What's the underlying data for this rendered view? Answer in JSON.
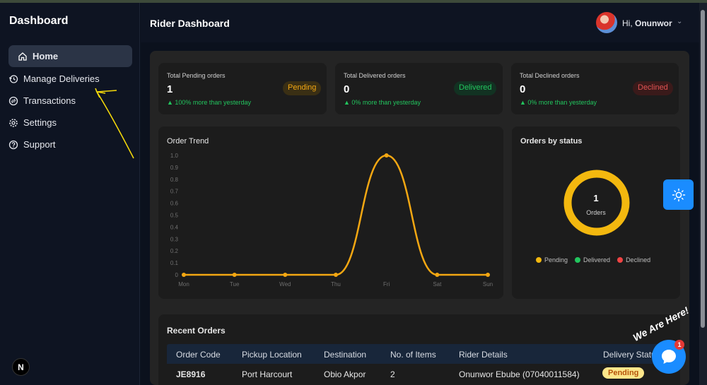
{
  "sidebar": {
    "brand": "Dashboard",
    "items": [
      {
        "label": "Home",
        "icon": "home-icon",
        "active": true
      },
      {
        "label": "Manage Deliveries",
        "icon": "history-icon"
      },
      {
        "label": "Transactions",
        "icon": "transactions-icon"
      },
      {
        "label": "Settings",
        "icon": "gear-icon"
      },
      {
        "label": "Support",
        "icon": "help-icon"
      }
    ],
    "badge": "N"
  },
  "header": {
    "title": "Rider Dashboard",
    "greeting": "Hi,",
    "user_name": "Onunwor"
  },
  "stats": [
    {
      "label": "Total Pending orders",
      "value": "1",
      "trend": "▲ 100% more than yesterday",
      "pill": "Pending"
    },
    {
      "label": "Total Delivered orders",
      "value": "0",
      "trend": "▲ 0% more than yesterday",
      "pill": "Delivered"
    },
    {
      "label": "Total Declined orders",
      "value": "0",
      "trend": "▲ 0% more than yesterday",
      "pill": "Declined"
    }
  ],
  "order_trend": {
    "title": "Order Trend"
  },
  "orders_by_status": {
    "title": "Orders by status",
    "center_value": "1",
    "center_label": "Orders",
    "legend": [
      {
        "name": "Pending",
        "color": "#f3b80f"
      },
      {
        "name": "Delivered",
        "color": "#22c55e"
      },
      {
        "name": "Declined",
        "color": "#ef4444"
      }
    ]
  },
  "chart_data": [
    {
      "type": "line",
      "title": "Order Trend",
      "categories": [
        "Mon",
        "Tue",
        "Wed",
        "Thu",
        "Fri",
        "Sat",
        "Sun"
      ],
      "values": [
        0,
        0,
        0,
        0,
        1,
        0,
        0
      ],
      "ylim": [
        0,
        1.0
      ],
      "yticks": [
        "0",
        "0.1",
        "0.2",
        "0.3",
        "0.4",
        "0.5",
        "0.6",
        "0.7",
        "0.8",
        "0.9",
        "1.0"
      ],
      "color": "#f3a712",
      "grid": false
    },
    {
      "type": "pie",
      "title": "Orders by status",
      "categories": [
        "Pending",
        "Delivered",
        "Declined"
      ],
      "values": [
        1,
        0,
        0
      ],
      "colors": [
        "#f3b80f",
        "#22c55e",
        "#ef4444"
      ],
      "legend": "bottom"
    }
  ],
  "recent_orders": {
    "title": "Recent Orders",
    "columns": [
      "Order Code",
      "Pickup Location",
      "Destination",
      "No. of Items",
      "Rider Details",
      "Delivery Status"
    ],
    "rows": [
      [
        "JE8916",
        "Port Harcourt",
        "Obio Akpor",
        "2",
        "Onunwor Ebube (07040011584)",
        "Pending"
      ]
    ]
  },
  "chat": {
    "banner": "We Are Here!",
    "unread": "1"
  }
}
